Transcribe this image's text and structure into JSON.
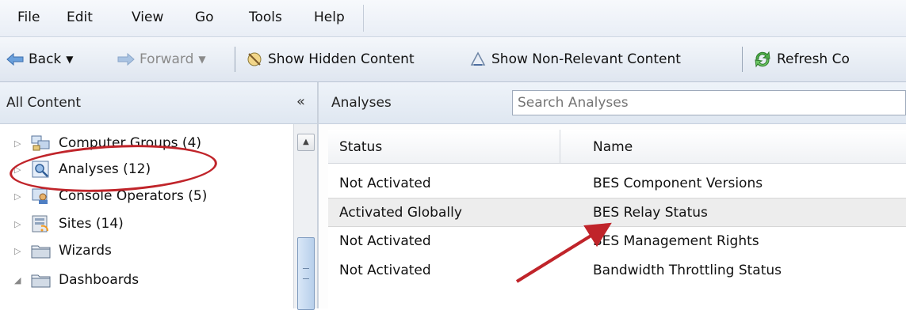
{
  "menu": [
    "File",
    "Edit",
    "View",
    "Go",
    "Tools",
    "Help"
  ],
  "toolbar": {
    "back": "Back",
    "forward": "Forward",
    "show_hidden": "Show Hidden Content",
    "show_non_relevant": "Show Non-Relevant Content",
    "refresh": "Refresh Co"
  },
  "left_pane": {
    "title": "All Content",
    "collapse_glyph": "«",
    "items": [
      {
        "label": "Computer Groups (4)",
        "icon": "computer-groups-icon"
      },
      {
        "label": "Analyses (12)",
        "icon": "analyses-icon"
      },
      {
        "label": "Console Operators (5)",
        "icon": "console-operators-icon"
      },
      {
        "label": "Sites (14)",
        "icon": "sites-icon"
      },
      {
        "label": "Wizards",
        "icon": "folder-icon"
      },
      {
        "label": "Dashboards",
        "icon": "folder-icon"
      }
    ]
  },
  "right_pane": {
    "title": "Analyses",
    "search_placeholder": "Search Analyses",
    "columns": [
      "Status",
      "Name"
    ],
    "rows": [
      {
        "status": "Not Activated",
        "name": "BES Component Versions"
      },
      {
        "status": "Activated Globally",
        "name": "BES Relay Status"
      },
      {
        "status": "Not Activated",
        "name": "BES Management Rights"
      },
      {
        "status": "Not Activated",
        "name": "Bandwidth Throttling Status"
      }
    ]
  },
  "colors": {
    "annotation": "#c0242a",
    "selection": "#ededed",
    "header": "#e4ebf4"
  }
}
